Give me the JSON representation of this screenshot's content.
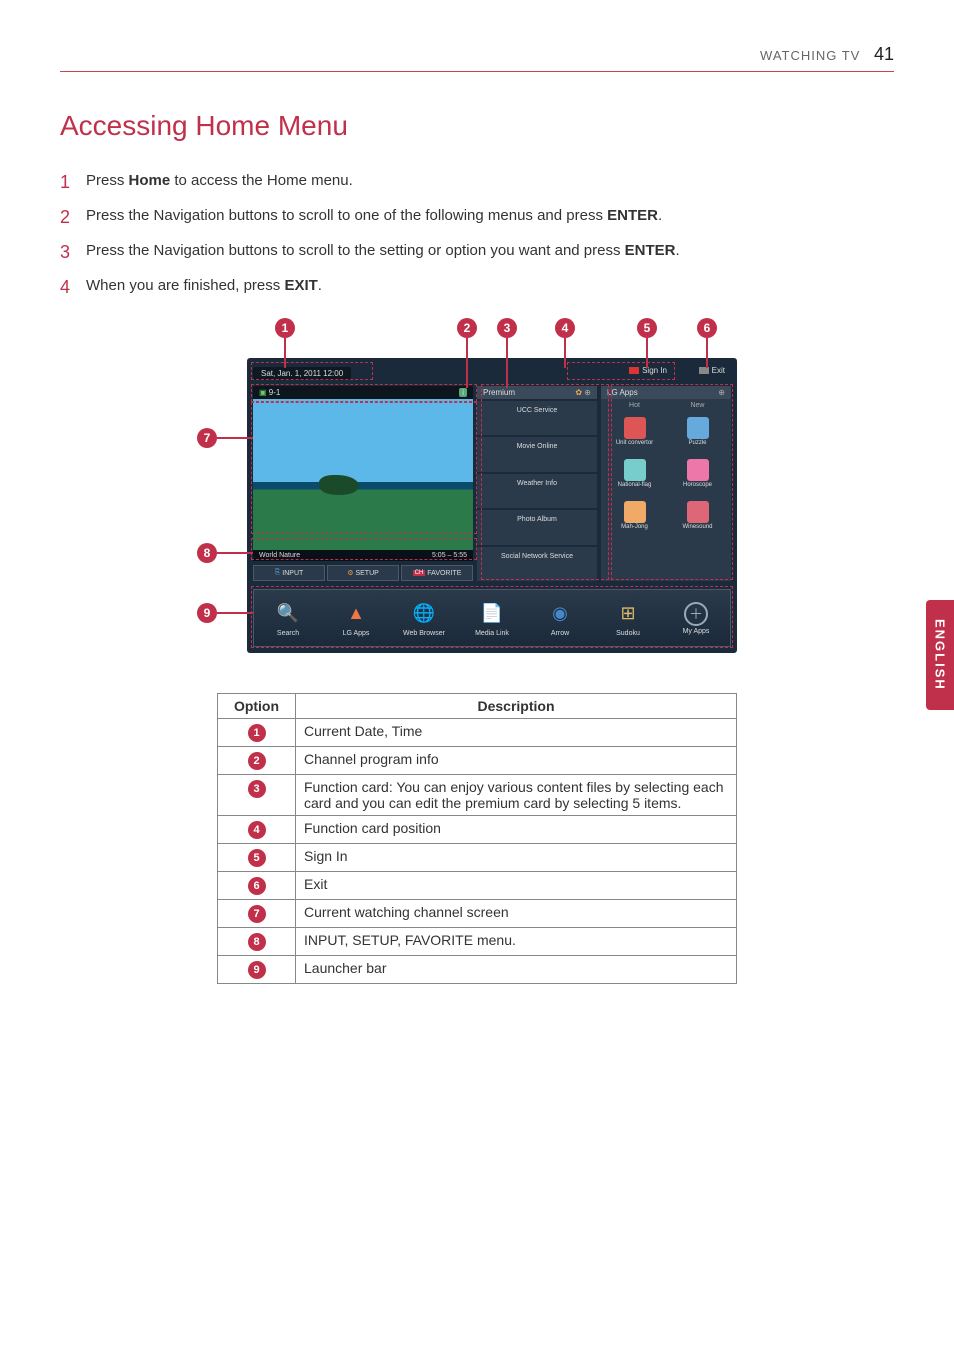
{
  "header": {
    "section": "WATCHING TV",
    "page": "41"
  },
  "title": "Accessing Home Menu",
  "steps": [
    {
      "n": "1",
      "pre": "Press ",
      "b": "Home",
      "post": " to access the Home menu."
    },
    {
      "n": "2",
      "pre": "Press the Navigation buttons to scroll to one of the following menus and press ",
      "b": "ENTER",
      "post": "."
    },
    {
      "n": "3",
      "pre": "Press the Navigation buttons to scroll to the setting or option you want and press ",
      "b": "ENTER",
      "post": "."
    },
    {
      "n": "4",
      "pre": "When you are finished, press ",
      "b": "EXIT",
      "post": "."
    }
  ],
  "tv": {
    "date": "Sat, Jan. 1, 2011  12:00",
    "channel": "9-1",
    "signin": "Sign In",
    "exit": "Exit",
    "video_title": "World Nature",
    "video_time": "5:05 – 5:55",
    "btn_input": "INPUT",
    "btn_setup": "SETUP",
    "btn_favorite": "FAVORITE",
    "premium_label": "Premium",
    "premium_items": [
      "UCC Service",
      "Movie Online",
      "Weather Info",
      "Photo Album",
      "Social Network Service"
    ],
    "apps_label": "LG Apps",
    "apps_hot": "Hot",
    "apps_new": "New",
    "apps": [
      {
        "name": "Unit convertor",
        "color": "#d55"
      },
      {
        "name": "Puzzle",
        "color": "#6ad"
      },
      {
        "name": "National-flag",
        "color": "#7cc"
      },
      {
        "name": "Horoscope",
        "color": "#e7a"
      },
      {
        "name": "Mah-Jong",
        "color": "#ea6"
      },
      {
        "name": "Winesound",
        "color": "#d67"
      }
    ],
    "launcher": [
      {
        "name": "Search",
        "glyph": "🔍",
        "color": "#4ad"
      },
      {
        "name": "LG Apps",
        "glyph": "▲",
        "color": "#e74"
      },
      {
        "name": "Web Browser",
        "glyph": "🌐",
        "color": "#5b5"
      },
      {
        "name": "Media Link",
        "glyph": "📄",
        "color": "#5bd"
      },
      {
        "name": "Arrow",
        "glyph": "◉",
        "color": "#48c"
      },
      {
        "name": "Sudoku",
        "glyph": "⊞",
        "color": "#db6"
      },
      {
        "name": "My Apps",
        "glyph": "＋",
        "color": "#9ab"
      }
    ]
  },
  "table": {
    "h1": "Option",
    "h2": "Description",
    "rows": [
      {
        "n": "1",
        "d": "Current Date, Time"
      },
      {
        "n": "2",
        "d": "Channel program info"
      },
      {
        "n": "3",
        "d": "Function card: You can enjoy various content files by selecting each card and you can edit the premium card by selecting 5 items."
      },
      {
        "n": "4",
        "d": "Function card position"
      },
      {
        "n": "5",
        "d": "Sign In"
      },
      {
        "n": "6",
        "d": "Exit"
      },
      {
        "n": "7",
        "d": "Current watching channel screen"
      },
      {
        "n": "8",
        "d": "INPUT, SETUP, FAVORITE menu."
      },
      {
        "n": "9",
        "d": "Launcher bar"
      }
    ]
  },
  "sidetab": "ENGLISH"
}
